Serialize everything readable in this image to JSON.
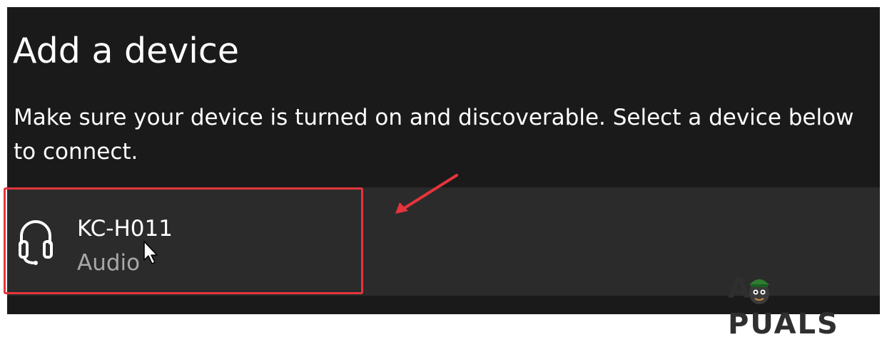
{
  "dialog": {
    "title": "Add a device",
    "description": "Make sure your device is turned on and discoverable. Select a device below to connect."
  },
  "devices": [
    {
      "name": "KC-H011",
      "type": "Audio",
      "icon": "headphone-icon"
    }
  ],
  "annotation": {
    "highlight_color": "#e5343c"
  },
  "watermark": {
    "text": "APPUALS"
  },
  "colors": {
    "background": "#1a1a1a",
    "row_background": "#2b2b2b",
    "primary_text": "#ffffff",
    "secondary_text": "#a8a8a8"
  }
}
